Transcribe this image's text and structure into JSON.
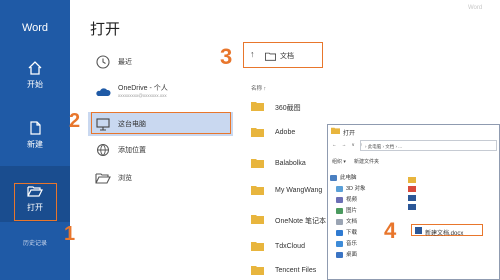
{
  "app": {
    "name": "Word",
    "watermark": "Word"
  },
  "rail": {
    "items": [
      {
        "label": "开始",
        "icon": "home-icon"
      },
      {
        "label": "新建",
        "icon": "new-document-icon"
      },
      {
        "label": "打开",
        "icon": "open-folder-icon"
      }
    ],
    "footer": "历史记录"
  },
  "open_pane": {
    "title": "打开",
    "locations": [
      {
        "label": "最近",
        "icon": "clock-icon"
      },
      {
        "label": "OneDrive - 个人",
        "sub": "xxxxxxxxx@xxxxxxx.xxx",
        "icon": "cloud-icon"
      },
      {
        "label": "这台电脑",
        "icon": "computer-icon"
      },
      {
        "label": "添加位置",
        "icon": "globe-add-icon"
      },
      {
        "label": "浏览",
        "icon": "folder-browse-icon"
      }
    ]
  },
  "steps": [
    "1",
    "2",
    "3",
    "4"
  ],
  "breadcrumb": {
    "current": "文档"
  },
  "folder_list": {
    "column_header": "名称 ↑",
    "folders": [
      "360截图",
      "Adobe",
      "Balabolka",
      "My WangWang",
      "OneNote 笔记本",
      "TdxCloud",
      "Tencent Files"
    ]
  },
  "explorer": {
    "title": "打开",
    "nav_arrows": "← → ∨ ↑",
    "path": "› 此电脑 › 文档 › ...",
    "organize": "组织 ▾",
    "new_folder": "新建文件夹",
    "nav_items": [
      "此电脑",
      "3D 对象",
      "视频",
      "图片",
      "文档",
      "下载",
      "音乐",
      "桌面"
    ],
    "files": [
      "",
      "",
      "",
      ""
    ],
    "new_doc": "新建文档.docx"
  },
  "colors": {
    "accent": "#1f5aa6",
    "highlight": "#e8762c",
    "selected": "#c9d8f0",
    "folder": "#e8b53d"
  }
}
